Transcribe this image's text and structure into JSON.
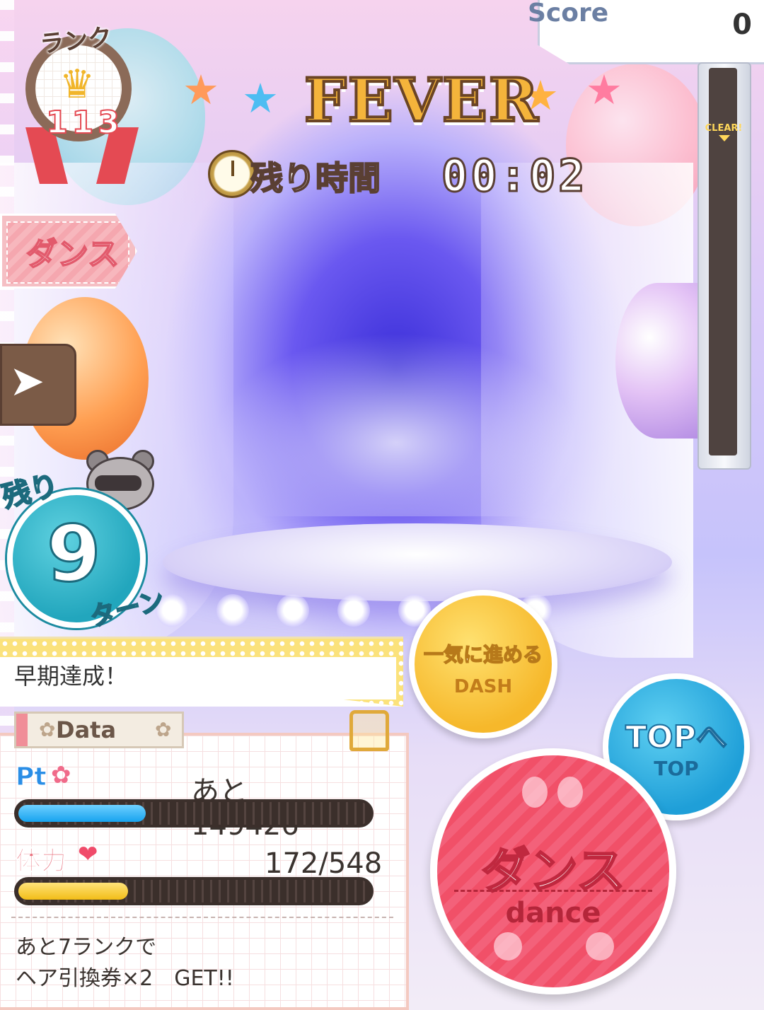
{
  "rank": {
    "label": "ランク",
    "value": "113"
  },
  "fever": {
    "title": "FEVER",
    "time_label": "残り時間",
    "time_value": "00:02"
  },
  "score": {
    "label": "Score",
    "value": "0"
  },
  "gauge": {
    "clear_label": "CLEAR!"
  },
  "side_tag": {
    "label": "ダンス"
  },
  "turns": {
    "prefix": "残り",
    "value": "9",
    "unit": "ターン"
  },
  "banner": {
    "text": "早期達成！"
  },
  "data_panel": {
    "tab_label": "Data",
    "pt": {
      "label": "Pt",
      "prefix": "あと",
      "value": "149426",
      "fill_percent": 36
    },
    "stamina": {
      "label": "体力",
      "value": "172/548",
      "fill_percent": 31
    },
    "reward_line1": "あと7ランクで",
    "reward_line2": "ヘア引換券×2　GET!!"
  },
  "buttons": {
    "dash": {
      "main": "一気に進める",
      "sub": "DASH"
    },
    "top": {
      "main": "TOPへ",
      "sub": "TOP"
    },
    "dance": {
      "main": "ダンス",
      "sub": "dance"
    }
  },
  "colors": {
    "accent_pink": "#f15068",
    "accent_blue": "#1f9fd8",
    "accent_yellow": "#f6b82b",
    "turns_teal": "#22a6bd"
  },
  "icons": [
    "crown-icon",
    "clock-icon",
    "star-icon",
    "arrow-right-icon",
    "raccoon-icon",
    "flower-icon",
    "heart-icon",
    "paperclip-icon",
    "paw-icon"
  ]
}
